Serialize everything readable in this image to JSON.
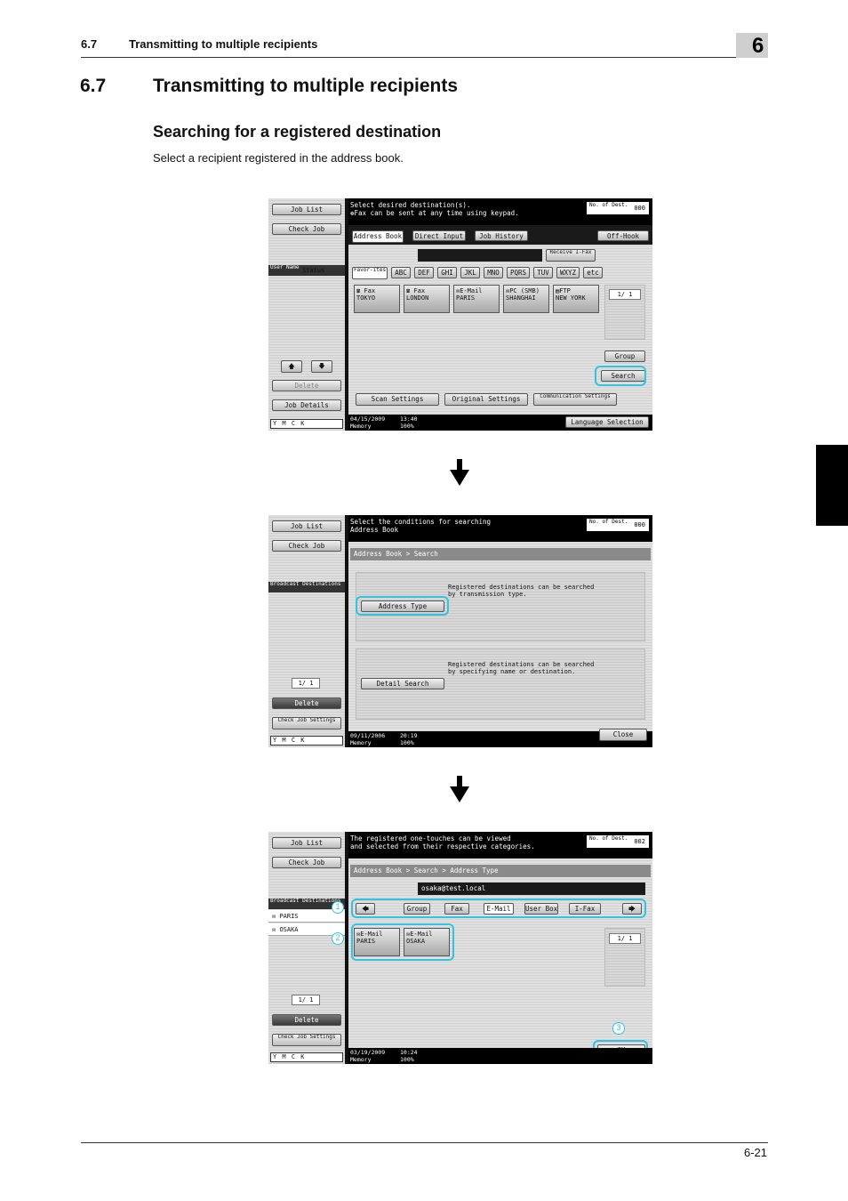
{
  "header": {
    "section_num": "6.7",
    "section_title": "Transmitting to multiple recipients",
    "chapter": "6"
  },
  "heading": {
    "num": "6.7",
    "title": "Transmitting to multiple recipients"
  },
  "subheading": "Searching for a registered destination",
  "intro": "Select a recipient registered in the address book.",
  "footer": {
    "page": "6-21"
  },
  "left_panel": {
    "job_list": "Job List",
    "check_job": "Check Job",
    "user_name": "User Name",
    "status": "Status",
    "delete": "Delete",
    "job_details": "Job Details",
    "broadcast": "Broadcast Destinations",
    "check_job_settings": "Check Job Settings",
    "ymck": "Y M C K"
  },
  "screen1": {
    "message": "Select desired destination(s).\n❁Fax can be sent at any time using keypad.",
    "counter_label": "No. of Dest.",
    "counter_value": "000",
    "tabs": [
      "Address Book",
      "Direct Input",
      "Job History"
    ],
    "off_hook": "Off-Hook",
    "receive_ifax": "Receive I-Fax",
    "index_tabs": [
      "Favor-ites",
      "ABC",
      "DEF",
      "GHI",
      "JKL",
      "MNO",
      "PQRS",
      "TUV",
      "WXYZ",
      "etc"
    ],
    "tiles": [
      "☎ Fax\nTOKYO",
      "☎ Fax\nLONDON",
      "✉E-Mail\nPARIS",
      "✉PC (SMB)\nSHANGHAI",
      "▤FTP\nNEW YORK"
    ],
    "page": "1/  1",
    "group": "Group",
    "search": "Search",
    "scan_settings": "Scan Settings",
    "original_settings": "Original Settings",
    "communication_settings": "Communication Settings",
    "date": "04/15/2009\nMemory",
    "time": "13:40\n100%",
    "language": "Language Selection"
  },
  "screen2": {
    "message": "Select the conditions for searching\nAddress Book",
    "counter_label": "No. of Dest.",
    "counter_value": "000",
    "breadcrumb": "Address Book > Search",
    "address_type": "Address Type",
    "address_type_desc": "Registered destinations can be searched\nby transmission type.",
    "detail_search": "Detail Search",
    "detail_search_desc": "Registered destinations can be searched\nby specifying name or destination.",
    "page": "1/  1",
    "date": "09/11/2006\nMemory",
    "time": "20:19\n100%",
    "close": "Close"
  },
  "screen3": {
    "message": "The registered one-touches can be viewed\nand selected from their respective categories.",
    "counter_label": "No. of Dest.",
    "counter_value": "002",
    "breadcrumb": "Address Book > Search > Address Type",
    "entered": "osaka@test.local",
    "categories": [
      "Group",
      "Fax",
      "E-Mail",
      "User Box",
      "I-Fax"
    ],
    "tiles": [
      "✉E-Mail\nPARIS",
      "✉E-Mail\nOSAKA"
    ],
    "list": [
      "PARIS",
      "OSAKA"
    ],
    "page": "1/  1",
    "callouts": [
      "1",
      "2",
      "3"
    ],
    "ok": "OK",
    "date": "03/19/2009\nMemory",
    "time": "10:24\n100%"
  }
}
